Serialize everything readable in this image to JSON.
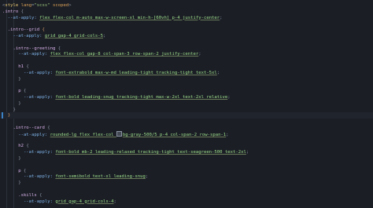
{
  "code": {
    "lines": [
      {
        "segments": [
          {
            "t": "<",
            "c": "t-punc"
          },
          {
            "t": "style",
            "c": "t-tag"
          },
          {
            "t": " lang",
            "c": "t-attr"
          },
          {
            "t": "=",
            "c": "t-punc"
          },
          {
            "t": "\"scss\"",
            "c": "t-str"
          },
          {
            "t": " scoped",
            "c": "t-attr"
          },
          {
            "t": ">",
            "c": "t-punc"
          }
        ]
      },
      {
        "segments": [
          {
            "t": ".intro ",
            "c": "t-sel"
          },
          {
            "t": "{",
            "c": "t-punc"
          }
        ]
      },
      {
        "segments": [
          {
            "t": "  --at-apply: ",
            "c": "t-prop"
          },
          {
            "t": "flex flex-col m-auto max-w-screen-xl min-h-[60vh] p-4 justify-center",
            "c": "t-cls"
          },
          {
            "t": ";",
            "c": "t-punc"
          }
        ]
      },
      {
        "segments": []
      },
      {
        "segments": [
          {
            "t": "  .intro--grid ",
            "c": "t-sel"
          },
          {
            "t": "{",
            "c": "t-bracket"
          }
        ]
      },
      {
        "segments": [
          {
            "t": "    --at-apply: ",
            "c": "t-prop"
          },
          {
            "t": "grid gap-4 grid-cols-5",
            "c": "t-cls"
          },
          {
            "t": ";",
            "c": "t-punc"
          }
        ]
      },
      {
        "segments": []
      },
      {
        "segments": [
          {
            "t": "    .intro--greeting ",
            "c": "t-sel"
          },
          {
            "t": "{",
            "c": "t-punc"
          }
        ]
      },
      {
        "segments": [
          {
            "t": "      --at-apply: ",
            "c": "t-prop"
          },
          {
            "t": "flex flex-col gap-8 col-span-3 row-span-2 justify-center",
            "c": "t-cls"
          },
          {
            "t": ";",
            "c": "t-punc"
          }
        ]
      },
      {
        "segments": []
      },
      {
        "segments": [
          {
            "t": "      h1 ",
            "c": "t-sel"
          },
          {
            "t": "{",
            "c": "t-punc"
          }
        ]
      },
      {
        "segments": [
          {
            "t": "        --at-apply: ",
            "c": "t-prop"
          },
          {
            "t": "font-extrabold max-w-md leading-tight tracking-tight text-5xl",
            "c": "t-cls"
          },
          {
            "t": ";",
            "c": "t-punc"
          }
        ]
      },
      {
        "segments": [
          {
            "t": "      }",
            "c": "t-punc"
          }
        ]
      },
      {
        "segments": []
      },
      {
        "segments": [
          {
            "t": "      p ",
            "c": "t-sel"
          },
          {
            "t": "{",
            "c": "t-punc"
          }
        ]
      },
      {
        "segments": [
          {
            "t": "        --at-apply: ",
            "c": "t-prop"
          },
          {
            "t": "font-bold leading-snug tracking-tight max-w-2xl text-2xl relative",
            "c": "t-cls"
          },
          {
            "t": ";",
            "c": "t-punc"
          }
        ]
      },
      {
        "segments": [
          {
            "t": "      }",
            "c": "t-punc"
          }
        ]
      },
      {
        "segments": [
          {
            "t": "    }",
            "c": "t-punc"
          }
        ]
      },
      {
        "segments": [
          {
            "t": "  }",
            "c": "t-bracket"
          }
        ],
        "active": true
      },
      {
        "segments": []
      },
      {
        "segments": [
          {
            "t": "    .intro--card ",
            "c": "t-sel"
          },
          {
            "t": "{",
            "c": "t-punc"
          }
        ]
      },
      {
        "segments": [
          {
            "t": "      --at-apply: ",
            "c": "t-prop"
          },
          {
            "t": "rounded-lg flex flex-col ",
            "c": "t-cls"
          },
          {
            "t": "bg-gray-500/5",
            "c": "t-cls",
            "swatch": true
          },
          {
            "t": " p-4 col-span-2 row-span-1",
            "c": "t-cls"
          },
          {
            "t": ";",
            "c": "t-punc"
          }
        ]
      },
      {
        "segments": []
      },
      {
        "segments": [
          {
            "t": "      h2 ",
            "c": "t-sel"
          },
          {
            "t": "{",
            "c": "t-punc"
          }
        ]
      },
      {
        "segments": [
          {
            "t": "        --at-apply: ",
            "c": "t-prop"
          },
          {
            "t": "font-bold mb-2 leading-relaxed tracking-tight text-seagreen-500 text-2xl",
            "c": "t-cls"
          },
          {
            "t": ";",
            "c": "t-punc"
          }
        ]
      },
      {
        "segments": [
          {
            "t": "      }",
            "c": "t-punc"
          }
        ]
      },
      {
        "segments": []
      },
      {
        "segments": [
          {
            "t": "      p ",
            "c": "t-sel"
          },
          {
            "t": "{",
            "c": "t-punc"
          }
        ]
      },
      {
        "segments": [
          {
            "t": "        --at-apply: ",
            "c": "t-prop"
          },
          {
            "t": "font-semibold text-xl leading-snug",
            "c": "t-cls"
          },
          {
            "t": ";",
            "c": "t-punc"
          }
        ]
      },
      {
        "segments": [
          {
            "t": "      }",
            "c": "t-punc"
          }
        ]
      },
      {
        "segments": []
      },
      {
        "segments": [
          {
            "t": "      .skills ",
            "c": "t-sel"
          },
          {
            "t": "{",
            "c": "t-punc"
          }
        ]
      },
      {
        "segments": [
          {
            "t": "        --at-apply: ",
            "c": "t-prop"
          },
          {
            "t": "grid gap-4 grid-cols-4",
            "c": "t-cls"
          },
          {
            "t": ";",
            "c": "t-punc"
          }
        ]
      }
    ]
  },
  "colors": {
    "background": "#1b1e25",
    "selector": "#d8b2ea",
    "property": "#7fb3e8",
    "utility_class": "#9fe08c",
    "bracket_match": "#d19a66",
    "active_line_marker": "#3b82c4"
  }
}
